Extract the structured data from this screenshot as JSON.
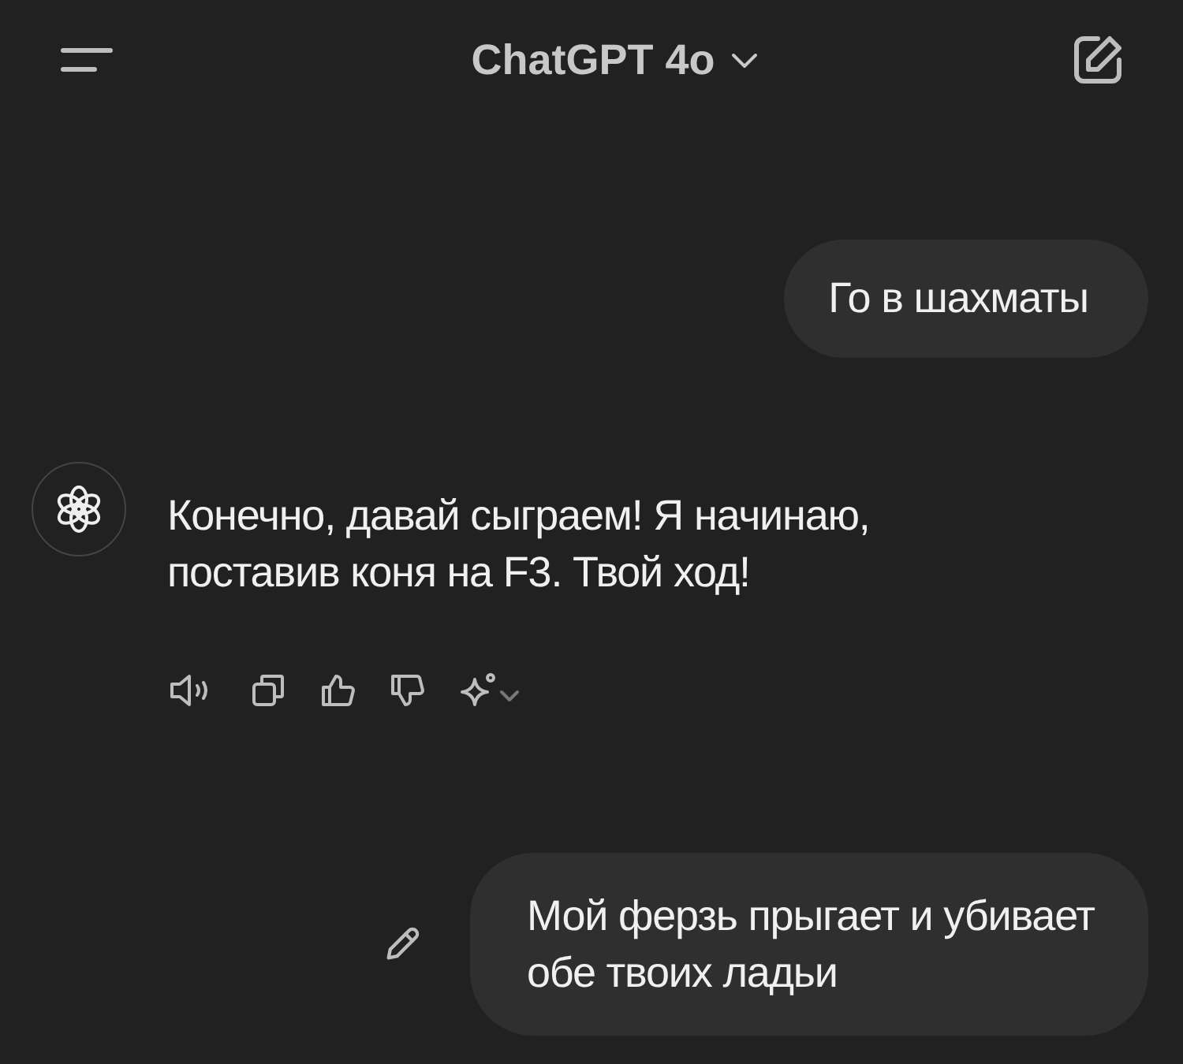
{
  "header": {
    "title": "ChatGPT 4o"
  },
  "messages": [
    {
      "kind": "user",
      "text": "Го в шахматы",
      "editable": false
    },
    {
      "kind": "assistant",
      "text": "Конечно, давай сыграем! Я начинаю, поставив коня на F3. Твой ход!"
    },
    {
      "kind": "user",
      "text": "Мой ферзь прыгает и убивает обе твоих ладьи",
      "editable": true
    }
  ]
}
